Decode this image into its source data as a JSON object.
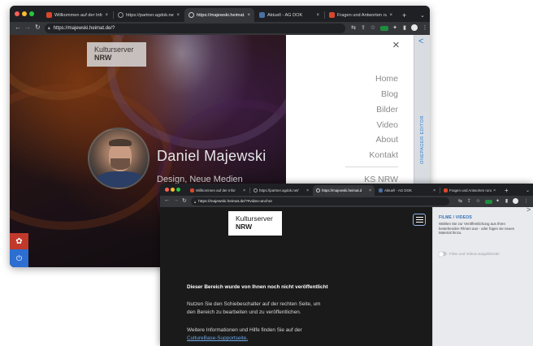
{
  "window1": {
    "tabs": [
      {
        "label": "Willkommen auf der Infor",
        "color": "#d9472b"
      },
      {
        "label": "https://partner.agdok.net/",
        "color": "#9aa0a6"
      },
      {
        "label": "https://majewski.heimat.d",
        "color": "#9aa0a6"
      },
      {
        "label": "Aktuell - AG DOK",
        "color": "#4a6fa5"
      },
      {
        "label": "Fragen und Antworten rund",
        "color": "#d9472b"
      }
    ],
    "close_glyph": "×",
    "new_tab_glyph": "+",
    "url": "https://majewski.heimat.de/?",
    "logo_line1": "Kulturserver",
    "logo_line2": "NRW",
    "name": "Daniel Majewski",
    "subtitle": "Design, Neue Medien",
    "menu_close": "×",
    "menu_items": [
      "Home",
      "Blog",
      "Bilder",
      "Video",
      "About",
      "Kontakt",
      "KS NRW"
    ],
    "editor_chevron": "<",
    "editor_label": "ONEPAGER EDITOR",
    "gear_glyph": "✿",
    "logout_glyph": "⏻"
  },
  "window2": {
    "tabs": [
      {
        "label": "Willkommen auf der Infor",
        "color": "#d9472b"
      },
      {
        "label": "https://partner.agdok.net/",
        "color": "#9aa0a6"
      },
      {
        "label": "https://majewski.heimat.d",
        "color": "#9aa0a6"
      },
      {
        "label": "Aktuell - AG DOK",
        "color": "#4a6fa5"
      },
      {
        "label": "Fragen und Antworten rund",
        "color": "#d9472b"
      }
    ],
    "close_glyph": "×",
    "new_tab_glyph": "+",
    "url": "https://majewski.heimat.de/?#video-anchor",
    "logo_line1": "Kulturserver",
    "logo_line2": "NRW",
    "notice_title": "Dieser Bereich wurde von Ihnen noch nicht veröffentlicht",
    "notice_line1": "Nutzen Sie den Schiebeschalter auf der rechten Seite, um",
    "notice_line2": "den Bereich zu bearbeiten und zu veröffentlichen.",
    "notice_line3": "Weitere Informationen und Hilfe finden Sie auf der",
    "notice_link": "CultureBase-Supportseite",
    "notice_link_suffix": ".",
    "panel_chevron": ">",
    "panel_title": "FILME / VIDEOS",
    "panel_desc": "Wählen Sie zur Veröffentlichung aus Ihren bestehenden Filmen aus - oder fügen sie neues Material hinzu.",
    "panel_toggle_label": "Filme und Videos ausgeblendet",
    "panel_toggle_on": false
  },
  "colors": {
    "accent_blue": "#2f7fd1",
    "chrome_dark": "#202124",
    "menu_text": "#8a8a8a"
  }
}
